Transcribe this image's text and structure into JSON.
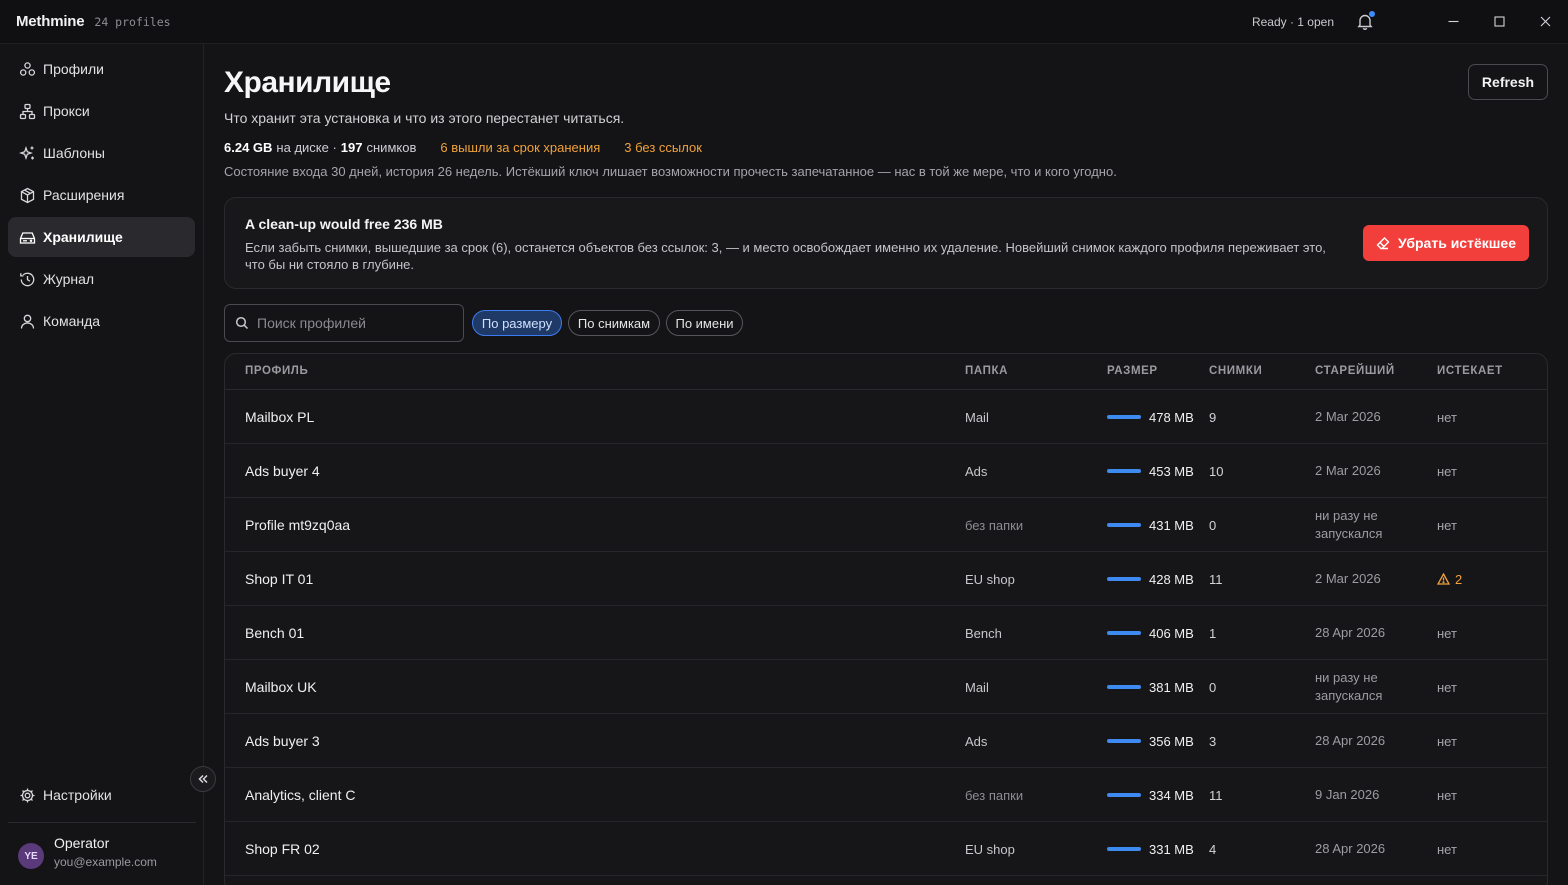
{
  "app": {
    "brand": "Methmine",
    "profile_count": "24 profiles",
    "status": "Ready · 1 open"
  },
  "sidebar": {
    "items": [
      {
        "label": "Профили",
        "icon": "profiles-icon"
      },
      {
        "label": "Прокси",
        "icon": "proxy-icon"
      },
      {
        "label": "Шаблоны",
        "icon": "templates-icon"
      },
      {
        "label": "Расширения",
        "icon": "extensions-icon"
      },
      {
        "label": "Хранилище",
        "icon": "storage-icon",
        "active": true
      },
      {
        "label": "Журнал",
        "icon": "history-icon"
      },
      {
        "label": "Команда",
        "icon": "team-icon"
      }
    ],
    "settings_label": "Настройки",
    "user": {
      "initials": "YE",
      "name": "Operator",
      "email": "you@example.com"
    }
  },
  "main": {
    "title": "Хранилище",
    "refresh_label": "Refresh",
    "subtitle": "Что хранит эта установка и что из этого перестанет читаться.",
    "stats": {
      "disk_value": "6.24 GB",
      "disk_label": "на диске ·",
      "snapshots_value": "197",
      "snapshots_label": "снимков",
      "expired": "6 вышли за срок хранения",
      "orphaned": "3 без ссылок"
    },
    "note": "Состояние входа 30 дней, история 26 недель. Истёкший ключ лишает возможности прочесть запечатанное — нас в той же мере, что и кого угодно.",
    "cleanup": {
      "title": "A clean-up would free 236 MB",
      "text": "Если забыть снимки, вышедшие за срок (6), останется объектов без ссылок: 3, — и место освобождает именно их удаление. Новейший снимок каждого профиля переживает это, что бы ни стояло в глубине.",
      "button": "Убрать истёкшее"
    },
    "search_placeholder": "Поиск профилей",
    "sort_chips": [
      "По размеру",
      "По снимкам",
      "По имени"
    ],
    "active_chip": 0,
    "table": {
      "headers": [
        "ПРОФИЛЬ",
        "ПАПКА",
        "РАЗМЕР",
        "СНИМКИ",
        "СТАРЕЙШИЙ",
        "ИСТЕКАЕТ"
      ],
      "rows": [
        {
          "name": "Mailbox PL",
          "folder": "Mail",
          "size": "478 MB",
          "snapshots": "9",
          "oldest": "2 Mar 2026",
          "expires": "нет"
        },
        {
          "name": "Ads buyer 4",
          "folder": "Ads",
          "size": "453 MB",
          "snapshots": "10",
          "oldest": "2 Mar 2026",
          "expires": "нет"
        },
        {
          "name": "Profile mt9zq0aa",
          "folder": "без папки",
          "size": "431 MB",
          "snapshots": "0",
          "oldest": "ни разу не запускался",
          "expires": "нет"
        },
        {
          "name": "Shop IT 01",
          "folder": "EU shop",
          "size": "428 MB",
          "snapshots": "11",
          "oldest": "2 Mar 2026",
          "expires": "2",
          "expires_warn": true
        },
        {
          "name": "Bench 01",
          "folder": "Bench",
          "size": "406 MB",
          "snapshots": "1",
          "oldest": "28 Apr 2026",
          "expires": "нет"
        },
        {
          "name": "Mailbox UK",
          "folder": "Mail",
          "size": "381 MB",
          "snapshots": "0",
          "oldest": "ни разу не запускался",
          "expires": "нет"
        },
        {
          "name": "Ads buyer 3",
          "folder": "Ads",
          "size": "356 MB",
          "snapshots": "3",
          "oldest": "28 Apr 2026",
          "expires": "нет"
        },
        {
          "name": "Analytics, client C",
          "folder": "без папки",
          "size": "334 MB",
          "snapshots": "11",
          "oldest": "9 Jan 2026",
          "expires": "нет"
        },
        {
          "name": "Shop FR 02",
          "folder": "EU shop",
          "size": "331 MB",
          "snapshots": "4",
          "oldest": "28 Apr 2026",
          "expires": "нет"
        }
      ]
    }
  },
  "colors": {
    "accent": "#3d8bf0",
    "danger": "#f23f3c",
    "warning": "#f0a23a"
  }
}
